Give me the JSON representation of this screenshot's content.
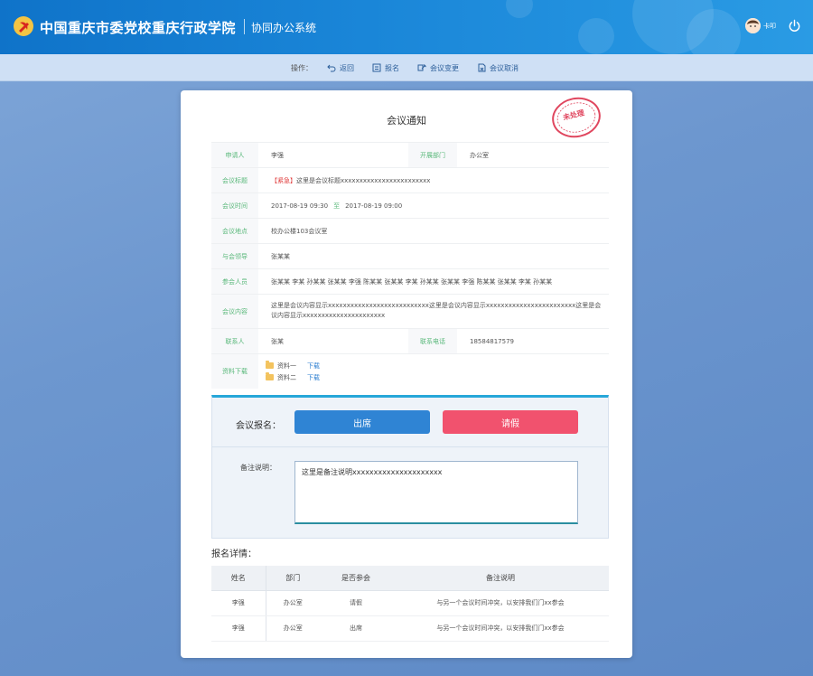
{
  "header": {
    "org_name": "中国重庆市委党校重庆行政学院",
    "system_name": "协同办公系统",
    "user_name": "卡叩"
  },
  "toolbar": {
    "label": "操作：",
    "buttons": [
      "返回",
      "报名",
      "会议变更",
      "会议取消"
    ]
  },
  "notice": {
    "title": "会议通知",
    "stamp": "未处理",
    "applicant_label": "申请人",
    "applicant": "李强",
    "dept_label": "开展部门",
    "dept": "办公室",
    "subject_label": "会议标题",
    "urgent_tag": "【紧急】",
    "subject": "这里是会议标题xxxxxxxxxxxxxxxxxxxxxxxx",
    "time_label": "会议时间",
    "time_start": "2017-08-19  09:30",
    "time_to": "至",
    "time_end": "2017-08-19  09:00",
    "place_label": "会议地点",
    "place": "校办公楼103会议室",
    "host_label": "与会领导",
    "host": "张某某",
    "attendees_label": "参会人员",
    "attendees": "张某某  李某  孙某某  张某某  李强  陈某某  张某某  李某  孙某某  张某某  李强  陈某某  张某某  李某  孙某某",
    "content_label": "会议内容",
    "content": "这里是会议内容显示xxxxxxxxxxxxxxxxxxxxxxxxxxx这里是会议内容显示xxxxxxxxxxxxxxxxxxxxxxxx这里是会议内容显示xxxxxxxxxxxxxxxxxxxxxx",
    "contact_label": "联系人",
    "contact": "张某",
    "phone_label": "联系电话",
    "phone": "18584817579",
    "files_label": "资料下载",
    "files": [
      {
        "name": "资料一",
        "action": "下载"
      },
      {
        "name": "资料二",
        "action": "下载"
      }
    ]
  },
  "registration": {
    "label": "会议报名：",
    "attend_button": "出席",
    "leave_button": "请假",
    "remark_label": "备注说明：",
    "remark_value": "这里是备注说明xxxxxxxxxxxxxxxxxxxxx"
  },
  "details": {
    "title": "报名详情：",
    "columns": [
      "姓名",
      "部门",
      "是否参会",
      "备注说明"
    ],
    "rows": [
      {
        "name": "李强",
        "dept": "办公室",
        "status": "请假",
        "remark": "与另一个会议时间冲突，以安排我们门xx参会"
      },
      {
        "name": "李强",
        "dept": "办公室",
        "status": "出席",
        "remark": "与另一个会议时间冲突，以安排我们门xx参会"
      }
    ]
  },
  "colors": {
    "header_blue": "#1a86d8",
    "label_green": "#59b87a",
    "attend_blue": "#2f84d4",
    "leave_red": "#f1526e",
    "urgent_red": "#e03b3b"
  }
}
